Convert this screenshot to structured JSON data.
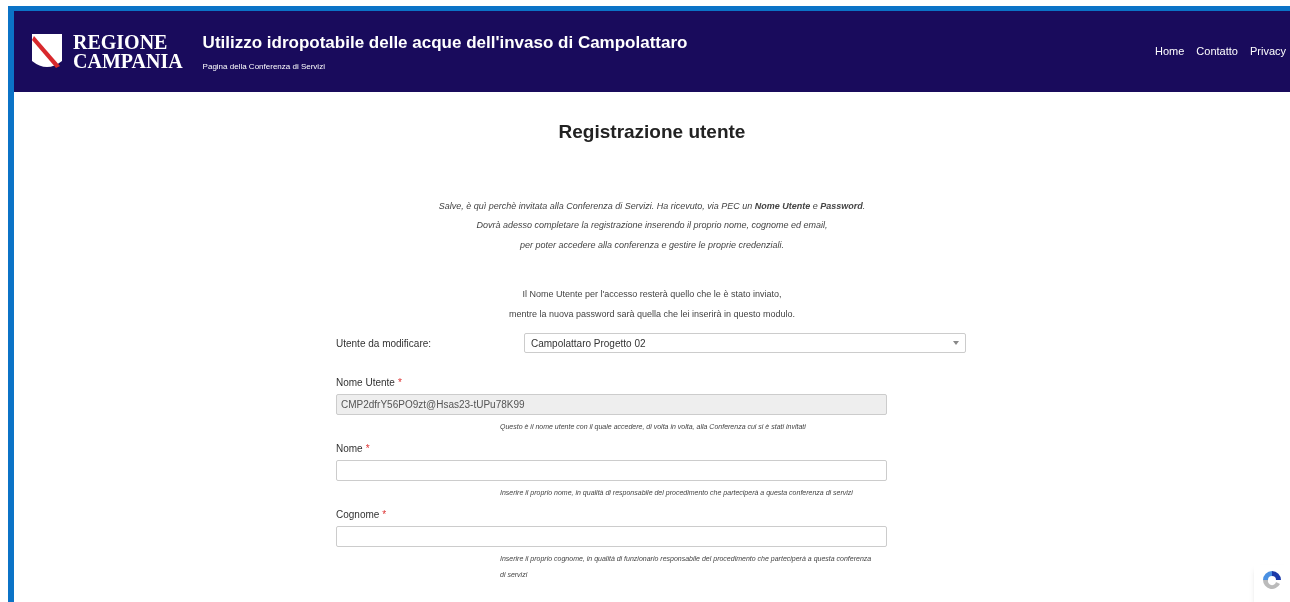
{
  "header": {
    "logo_lines": [
      "REGIONE",
      "CAMPANIA"
    ],
    "title": "Utilizzo idropotabile delle acque dell'invaso di Campolattaro",
    "subtitle": "Pagina della Conferenza di Servizi"
  },
  "nav": [
    "Home",
    "Contatto",
    "Privacy"
  ],
  "page_title": "Registrazione utente",
  "intro": [
    "Salve, è quì perchè invitata alla Conferenza di Servizi. Ha ricevuto, via PEC un **Nome Utente** e **Password**.",
    "Dovrà adesso completare la registrazione inserendo il proprio nome, cognome ed email,",
    "per poter accedere alla conferenza e gestire le proprie credenziali."
  ],
  "note": [
    "Il Nome Utente per l'accesso resterà quello che le è stato inviato,",
    "mentre la nuova password sarà quella che lei inserirà in questo modulo."
  ],
  "user_select": {
    "label": "Utente da modificare:",
    "value": "Campolattaro Progetto 02"
  },
  "fields": [
    {
      "label": "Nome Utente",
      "required_mark": "*",
      "value": "CMP2dfrY56PO9zt@Hsas23-tUPu78K99",
      "disabled": true,
      "hint": "Questo è il nome utente con il quale accedere, di volta in volta, alla Conferenza cui si è stati invitati"
    },
    {
      "label": "Nome",
      "required_mark": "*",
      "disabled": false,
      "hint": "Inserire il proprio nome, in qualità di responsabile del procedimento che parteciperà a questa conferenza di servizi"
    },
    {
      "label": "Cognome",
      "required_mark": "*",
      "disabled": false,
      "hint": "Inserire il proprio cognome, in qualità di funzionario responsabile del procedimento che parteciperà a questa conferenza di servizi"
    }
  ]
}
